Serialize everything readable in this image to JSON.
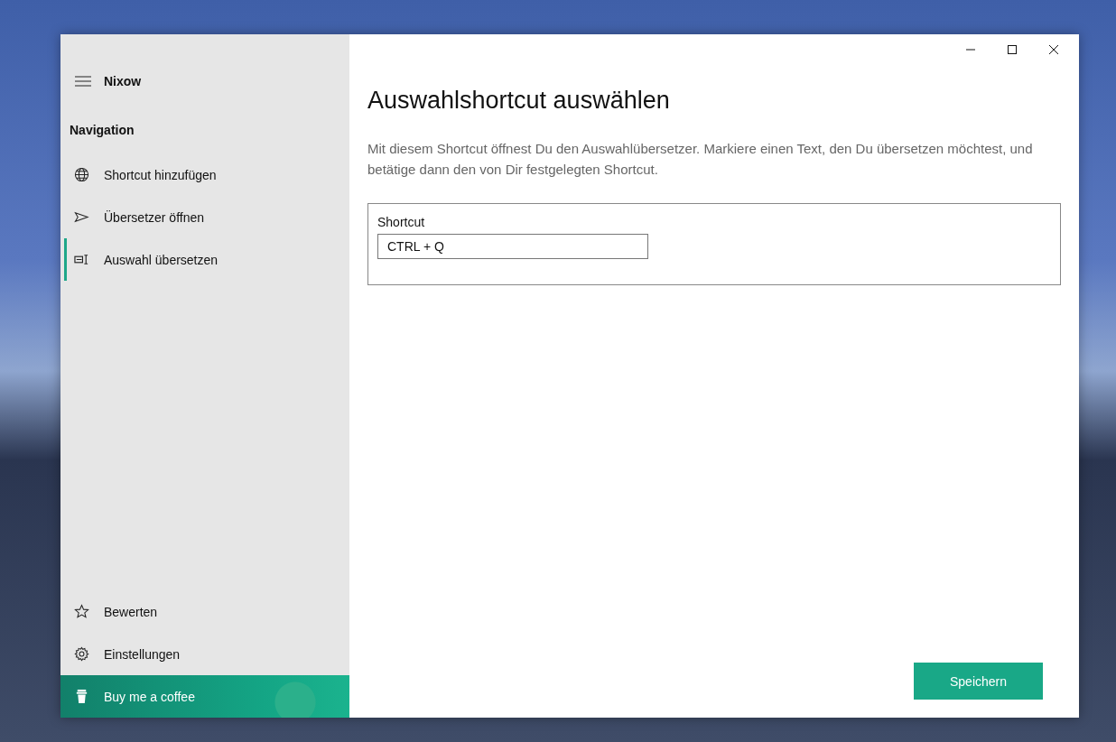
{
  "app": {
    "title": "Nixow"
  },
  "navigation": {
    "heading": "Navigation",
    "items": [
      {
        "label": "Shortcut hinzufügen",
        "selected": false
      },
      {
        "label": "Übersetzer öffnen",
        "selected": false
      },
      {
        "label": "Auswahl übersetzen",
        "selected": true
      }
    ]
  },
  "footer_items": [
    {
      "label": "Bewerten"
    },
    {
      "label": "Einstellungen"
    }
  ],
  "coffee_button": {
    "label": "Buy me a coffee"
  },
  "page": {
    "title": "Auswahlshortcut auswählen",
    "description": "Mit diesem Shortcut öffnest Du den Auswahlübersetzer. Markiere einen Text, den Du übersetzen möchtest, und betätige dann den von Dir festgelegten Shortcut.",
    "field": {
      "label": "Shortcut",
      "value": "CTRL + Q"
    },
    "save_button": "Speichern"
  }
}
